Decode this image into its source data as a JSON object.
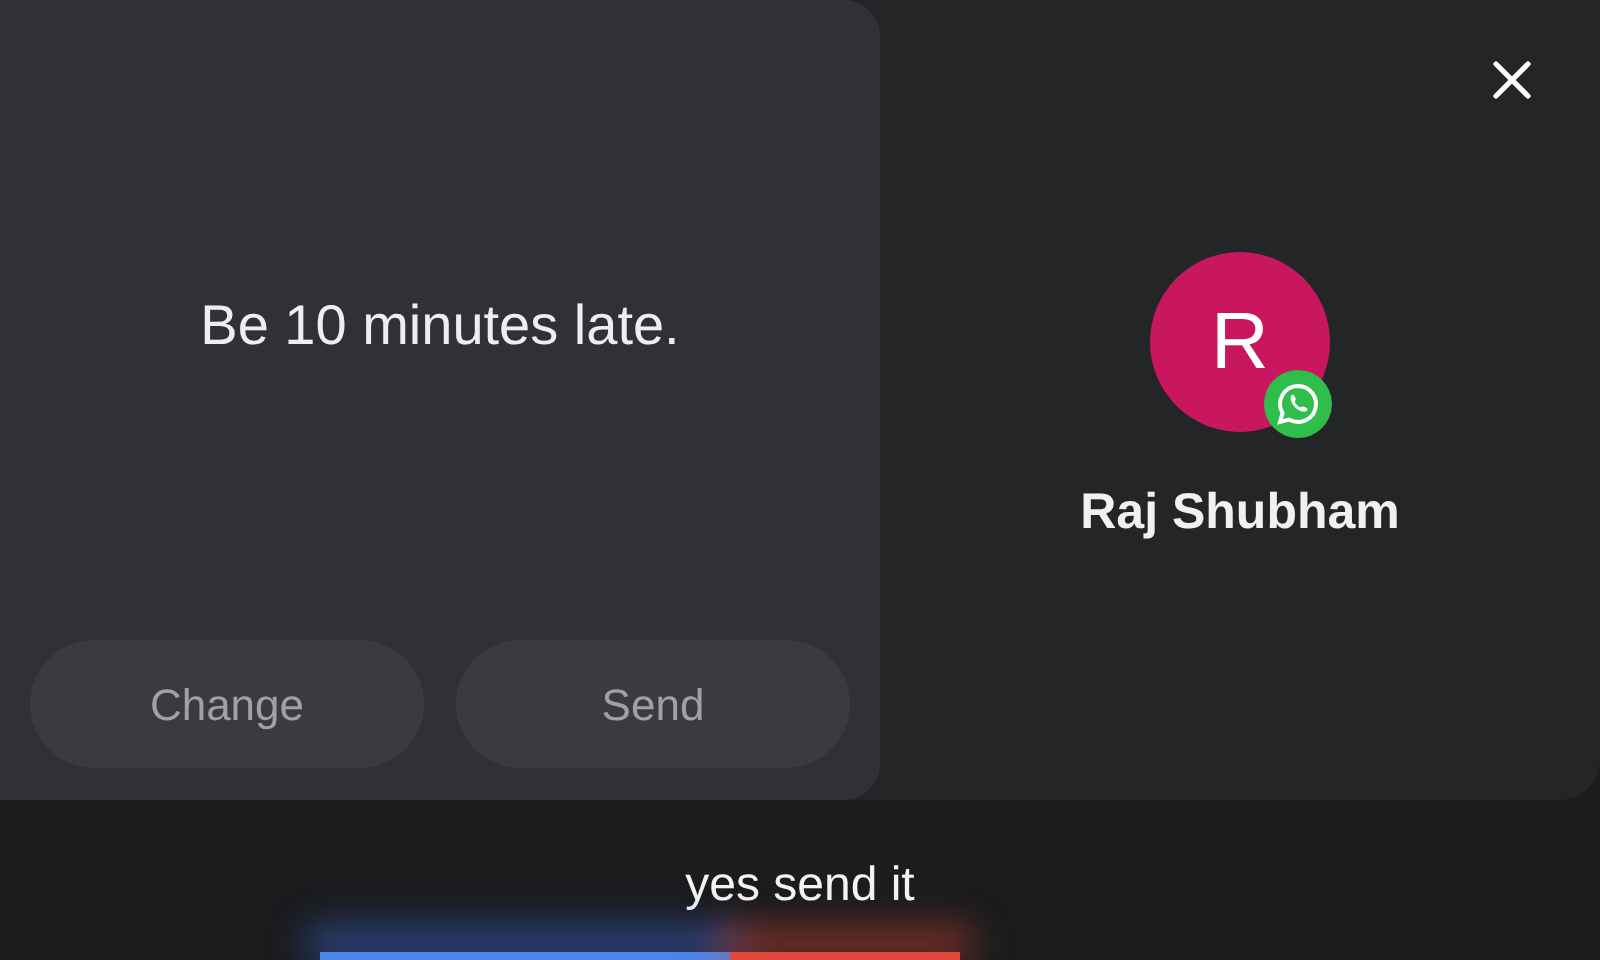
{
  "message": {
    "text": "Be 10 minutes late."
  },
  "buttons": [
    {
      "label": "Change"
    },
    {
      "label": "Send"
    }
  ],
  "contact": {
    "initial": "R",
    "name": "Raj Shubham"
  },
  "transcript": "yes send it"
}
